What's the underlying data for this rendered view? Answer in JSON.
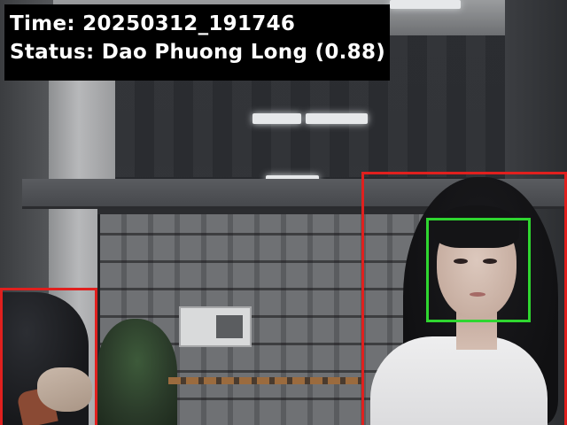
{
  "hud": {
    "time_label": "Time:",
    "time_value": "20250312_191746",
    "status_label": "Status:",
    "status_value": "Dao Phuong Long (0.88)"
  },
  "detections": {
    "person_box_color": "#e0201e",
    "face_box_color": "#2fd630"
  },
  "colors": {
    "hud_background": "#000000",
    "hud_text": "#ffffff"
  }
}
